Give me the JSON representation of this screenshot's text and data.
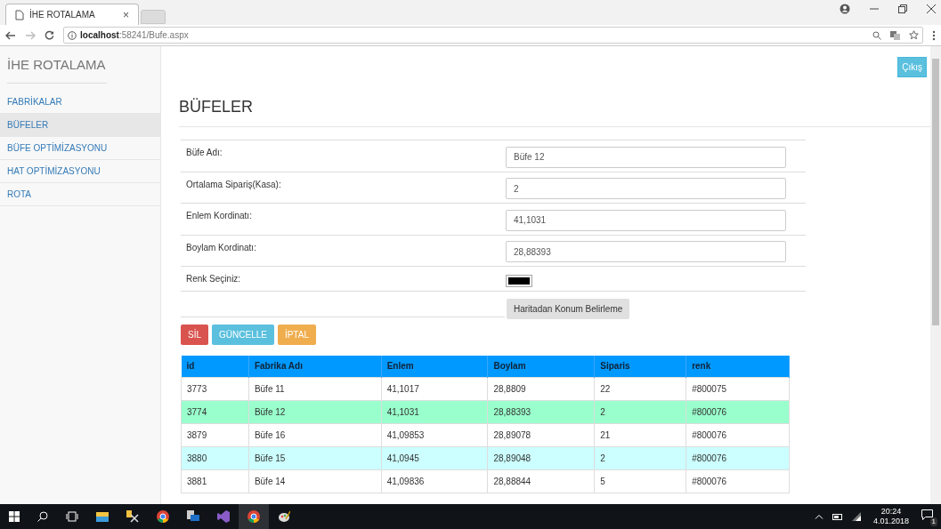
{
  "browser": {
    "tab_title": "İHE ROTALAMA",
    "tab_close": "×",
    "url": "**localhost**:58241/Bufe.aspx"
  },
  "sidebar": {
    "title": "İHE ROTALAMA",
    "items": [
      {
        "label": "FABRİKALAR",
        "selected": false
      },
      {
        "label": "BÜFELER",
        "selected": true
      },
      {
        "label": "BÜFE OPTİMİZASYONU",
        "selected": false
      },
      {
        "label": "HAT OPTİMİZASYONU",
        "selected": false
      },
      {
        "label": "ROTA",
        "selected": false
      }
    ]
  },
  "logout_button": "Çıkış",
  "heading": "BÜFELER",
  "form": {
    "fields": [
      {
        "kind": "text",
        "label": "Büfe Adı:",
        "value": "Büfe 12"
      },
      {
        "kind": "text",
        "label": "Ortalama Sipariş(Kasa):",
        "value": "2"
      },
      {
        "kind": "text",
        "label": "Enlem Kordinatı:",
        "value": "41,1031"
      },
      {
        "kind": "text",
        "label": "Boylam Kordinatı:",
        "value": "28,88393"
      },
      {
        "kind": "color",
        "label": "Renk Seçiniz:",
        "color": "#000000"
      }
    ],
    "map_button": "Haritadan Konum Belirleme"
  },
  "actions": [
    {
      "label": "SİL",
      "color": "#d9534f"
    },
    {
      "label": "GÜNCELLE",
      "color": "#5bc0de"
    },
    {
      "label": "İPTAL",
      "color": "#f0ad4e"
    }
  ],
  "table": {
    "columns": [
      "id",
      "Fabrika Adı",
      "Enlem",
      "Boylam",
      "Siparis",
      "renk"
    ],
    "rows": [
      {
        "cells": [
          "3773",
          "Büfe 11",
          "41,1017",
          "28,8809",
          "22",
          "#800075"
        ],
        "selected": false
      },
      {
        "cells": [
          "3774",
          "Büfe 12",
          "41,1031",
          "28,88393",
          "2",
          "#800076"
        ],
        "selected": true
      },
      {
        "cells": [
          "3879",
          "Büfe 16",
          "41,09853",
          "28,89078",
          "21",
          "#800076"
        ],
        "selected": false
      },
      {
        "cells": [
          "3880",
          "Büfe 15",
          "41,0945",
          "28,89048",
          "2",
          "#800076"
        ],
        "selected": false
      },
      {
        "cells": [
          "3881",
          "Büfe 14",
          "41,09836",
          "28,88844",
          "5",
          "#800076"
        ],
        "selected": false
      }
    ]
  },
  "taskbar": {
    "time": "20:24",
    "date": "4.01.2018",
    "notification_count": "1"
  }
}
